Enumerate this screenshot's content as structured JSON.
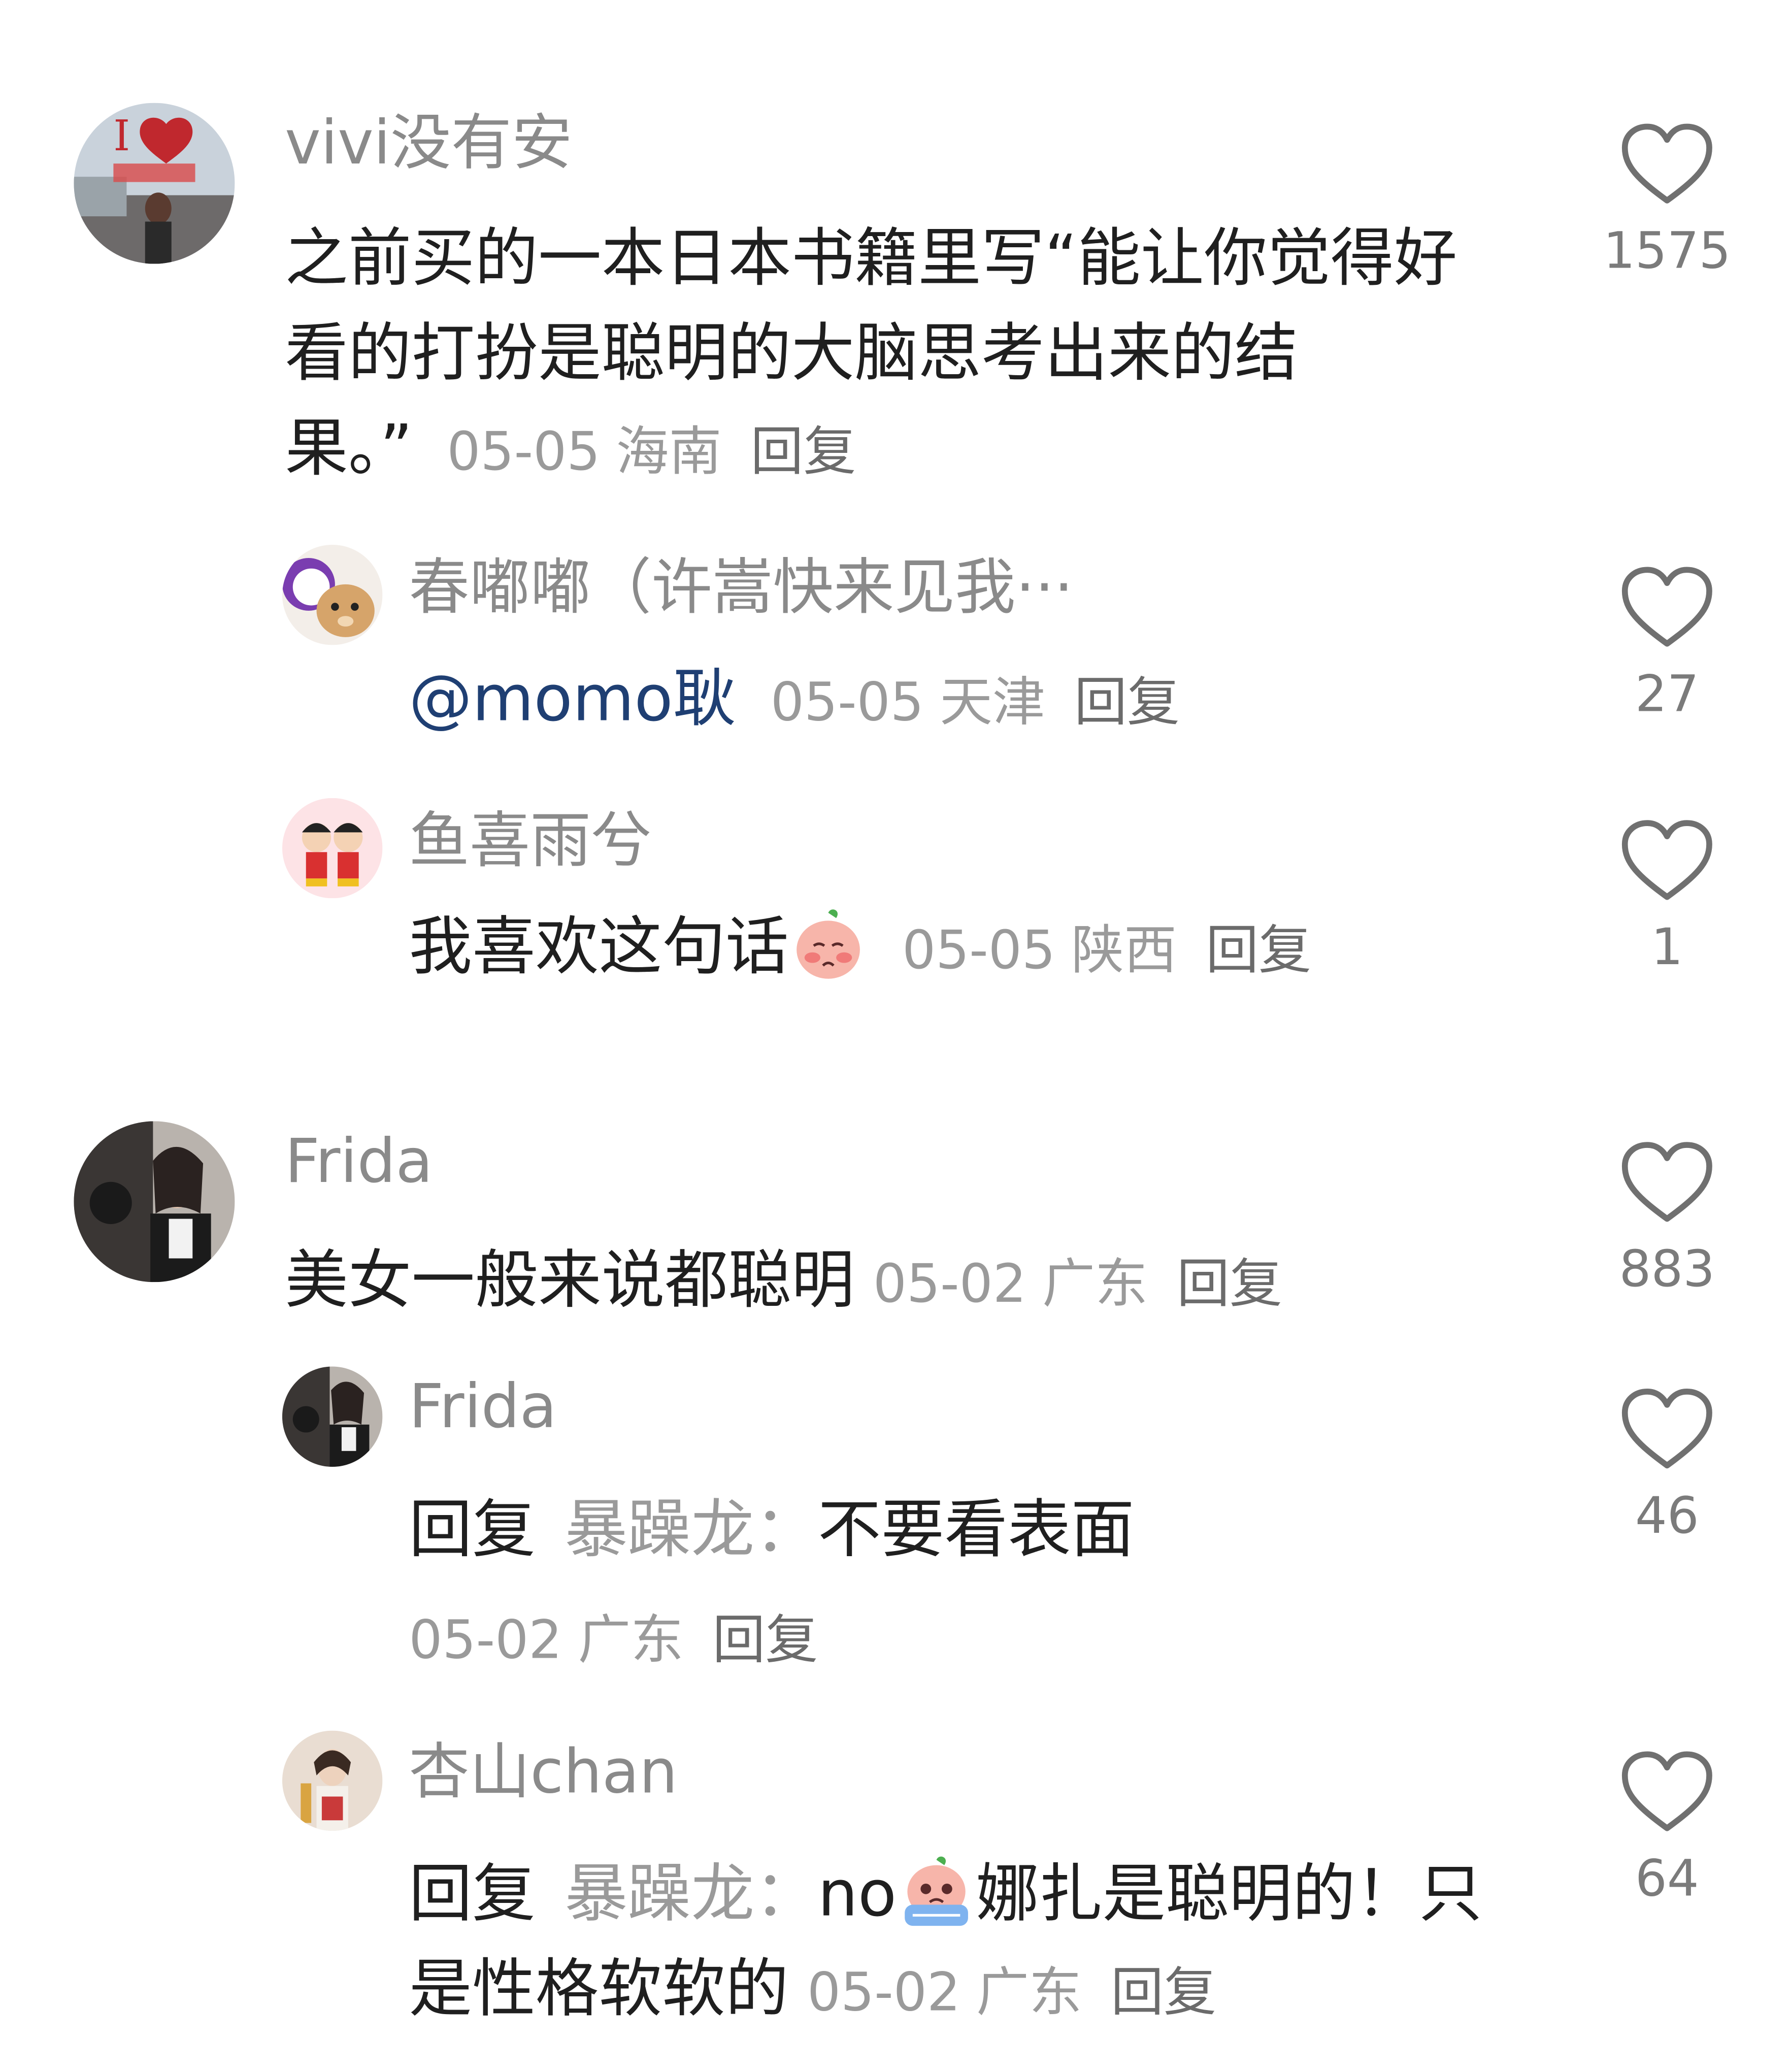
{
  "comments": [
    {
      "username": "vivi没有安",
      "text": "之前买的一本日本书籍里写“能让你觉得好看的打扮是聪明的大脑思考出来的结果。”",
      "date": "05-05",
      "location": "海南",
      "reply_label": "回复",
      "likes": "1575",
      "avatar_icon": "avatar-i-love-photo"
    },
    {
      "username": "春嘟嘟（许嵩快来见我···",
      "mention": "@momo耿",
      "date": "05-05",
      "location": "天津",
      "reply_label": "回复",
      "likes": "27",
      "avatar_icon": "avatar-cat"
    },
    {
      "username": "鱼喜雨兮",
      "text": "我喜欢这句话",
      "emoji_icon": "shy-peach-emoji-icon",
      "date": "05-05",
      "location": "陕西",
      "reply_label": "回复",
      "likes": "1",
      "avatar_icon": "avatar-cartoon-kids"
    },
    {
      "username": "Frida",
      "text": "美女一般来说都聪明",
      "date": "05-02",
      "location": "广东",
      "reply_label": "回复",
      "likes": "883",
      "avatar_icon": "avatar-portrait"
    },
    {
      "username": "Frida",
      "reply_prefix": "回复",
      "reply_target": "暴躁龙：",
      "text": "不要看表面",
      "date": "05-02",
      "location": "广东",
      "reply_label": "回复",
      "likes": "46",
      "avatar_icon": "avatar-portrait"
    },
    {
      "username": "杏山chan",
      "reply_prefix": "回复",
      "reply_target": "暴躁龙：",
      "text_before_emoji": "no",
      "emoji_icon": "crying-peach-emoji-icon",
      "text_after_emoji": "娜扎是聪明的！只是性格软软的",
      "date": "05-02",
      "location": "广东",
      "reply_label": "回复",
      "likes": "64",
      "avatar_icon": "avatar-woman"
    }
  ],
  "colors": {
    "username": "#8a8a8a",
    "text": "#1f1f1f",
    "meta": "#9a9a9a",
    "mention": "#1f3f73",
    "heart_outline": "#707070"
  }
}
